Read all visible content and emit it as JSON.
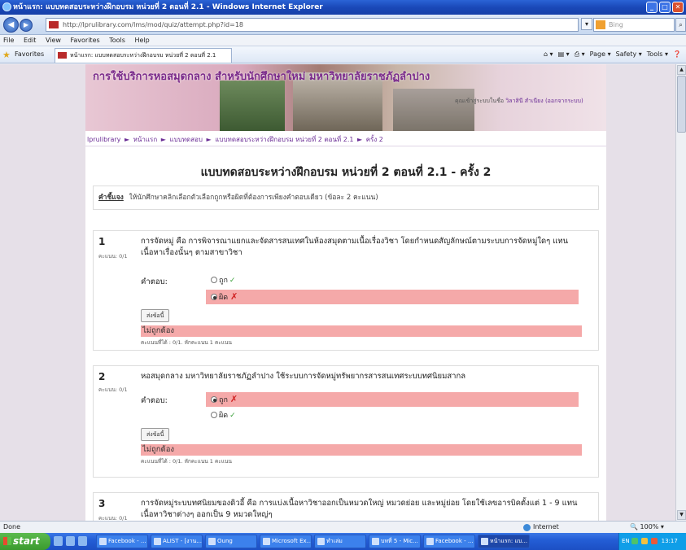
{
  "window": {
    "title": "หน้าแรก: แบบทดสอบระหว่างฝึกอบรม หน่วยที่ 2 ตอนที่ 2.1 - Windows Internet Explorer",
    "buttons": {
      "minimize": "_",
      "maximize": "□",
      "close": "✕"
    }
  },
  "address_bar": {
    "url": "http://lprulibrary.com/lms/mod/quiz/attempt.php?id=18",
    "search_placeholder": "Bing",
    "back": "◀",
    "forward": "▶"
  },
  "menu": [
    "File",
    "Edit",
    "View",
    "Favorites",
    "Tools",
    "Help"
  ],
  "favorites": {
    "label": "Favorites",
    "tab_title": "หน้าแรก: แบบทดสอบระหว่างฝึกอบรม หน่วยที่ 2 ตอนที่ 2.1",
    "commands": [
      "Page ▾",
      "Safety ▾",
      "Tools ▾"
    ]
  },
  "page": {
    "banner_title": "การใช้บริการหอสมุดกลาง สำหรับนักศึกษาใหม่ มหาวิทยาลัยราชภัฏลำปาง",
    "user_prefix": "คุณเข้าสู่ระบบในชื่อ",
    "user_name": "วิลาสินี สำเนียง",
    "logout": "(ออกจากระบบ)",
    "breadcrumb": [
      "lprulibrary",
      "หน้าแรก",
      "แบบทดสอบ",
      "แบบทดสอบระหว่างฝึกอบรม หน่วยที่ 2 ตอนที่ 2.1",
      "ครั้ง 2"
    ],
    "breadcrumb_sep": "►",
    "heading": "แบบทดสอบระหว่างฝึกอบรม หน่วยที่ 2 ตอนที่ 2.1 - ครั้ง 2",
    "instruction_label": "คำชี้แจง",
    "instruction_text": "ให้นักศึกษาคลิกเลือกตัวเลือกถูกหรือผิดที่ต้องการเพียงคำตอบเดียว (ข้อละ 2 คะแนน)",
    "answer_label": "คำตอบ:",
    "submit_label": "ส่งข้อนี้",
    "questions": [
      {
        "number": "1",
        "score": "คะแนน: 0/1",
        "text": "การจัดหมู่ คือ การพิจารณาแยกและจัดสารสนเทศในห้องสมุดตามเนื้อเรื่องวิชา โดยกำหนดสัญลักษณ์ตามระบบการจัดหมู่ใดๆ แทนเนื้อหาเรื่องนั้นๆ ตามสาขาวิชา",
        "options": [
          {
            "label": "ถูก",
            "mark": "✓"
          },
          {
            "label": "ผิด",
            "mark": "✗"
          }
        ],
        "feedback": "ไม่ถูกต้อง",
        "penalty": "คะแนนที่ได้ : 0/1. หักคะแนน 1 คะแนน"
      },
      {
        "number": "2",
        "score": "คะแนน: 0/1",
        "text": "หอสมุดกลาง มหาวิทยาลัยราชภัฏลำปาง ใช้ระบบการจัดหมู่ทรัพยากรสารสนเทศระบบทศนิยมสากล",
        "options": [
          {
            "label": "ถูก",
            "mark": "✗"
          },
          {
            "label": "ผิด",
            "mark": "✓"
          }
        ],
        "feedback": "ไม่ถูกต้อง",
        "penalty": "คะแนนที่ได้ : 0/1. หักคะแนน 1 คะแนน"
      },
      {
        "number": "3",
        "score": "คะแนน: 0/1",
        "text": "การจัดหมู่ระบบทศนิยมของดิวอี้ คือ การแบ่งเนื้อหาวิชาออกเป็นหมวดใหญ่ หมวดย่อย และหมู่ย่อย โดยใช้เลขอารบิคตั้งแต่ 1 - 9 แทนเนื้อหาวิชาต่างๆ ออกเป็น 9 หมวดใหญ่ๆ"
      }
    ]
  },
  "status_bar": {
    "left": "Done",
    "zone": "Internet",
    "zoom": "100%"
  },
  "taskbar": {
    "start": "start",
    "tasks": [
      "Facebook - ...",
      "ALIST - [งาน...",
      "Oung",
      "Microsoft Ex...",
      "ทำเล่ม",
      "บทที่ 5 - Mic...",
      "Facebook - ...",
      "หน้าแรก: แบ..."
    ],
    "tray_lang": "EN",
    "clock": "13:17"
  }
}
